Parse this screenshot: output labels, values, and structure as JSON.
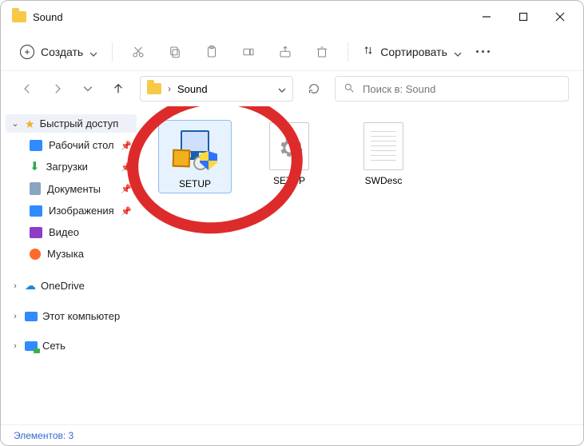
{
  "window": {
    "title": "Sound"
  },
  "toolbar": {
    "create_label": "Создать",
    "sort_label": "Сортировать"
  },
  "breadcrumb": {
    "current": "Sound"
  },
  "search": {
    "placeholder": "Поиск в: Sound"
  },
  "sidebar": {
    "quick_access": "Быстрый доступ",
    "items": [
      {
        "label": "Рабочий стол"
      },
      {
        "label": "Загрузки"
      },
      {
        "label": "Документы"
      },
      {
        "label": "Изображения"
      },
      {
        "label": "Видео"
      },
      {
        "label": "Музыка"
      }
    ],
    "onedrive": "OneDrive",
    "this_pc": "Этот компьютер",
    "network": "Сеть"
  },
  "files": [
    {
      "name": "SETUP"
    },
    {
      "name": "SETUP"
    },
    {
      "name": "SWDesc"
    }
  ],
  "status": {
    "text": "Элементов: 3"
  }
}
